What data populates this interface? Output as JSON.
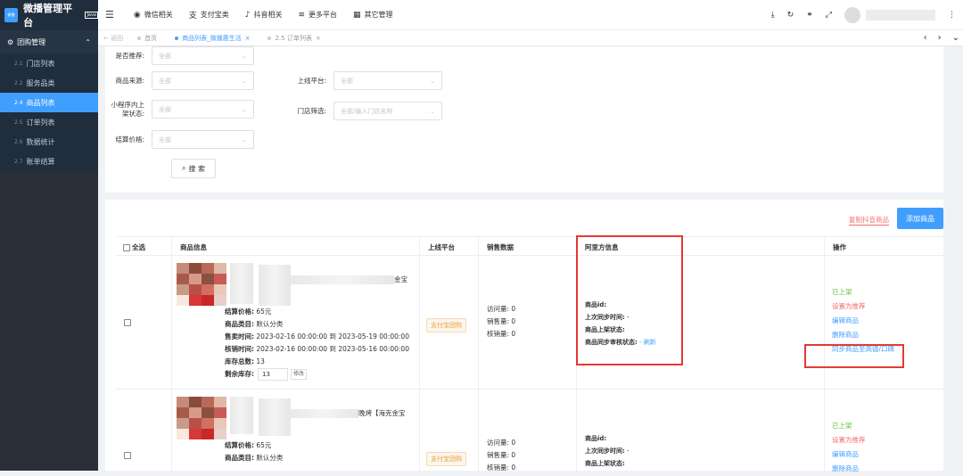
{
  "app": {
    "logo_badge": "微播\n助手",
    "title": "微播管理平台",
    "title_badge": "Java"
  },
  "sidebar": {
    "group": "团购管理",
    "items": [
      {
        "num": "2.1",
        "label": "门店列表"
      },
      {
        "num": "2.2",
        "label": "服务品类"
      },
      {
        "num": "2.4",
        "label": "商品列表"
      },
      {
        "num": "2.5",
        "label": "订单列表"
      },
      {
        "num": "2.6",
        "label": "数据统计"
      },
      {
        "num": "2.7",
        "label": "账单结算"
      }
    ]
  },
  "topnav": {
    "items": [
      "微信相关",
      "支付宝类",
      "抖音相关",
      "更多平台",
      "其它管理"
    ]
  },
  "tabs": {
    "back": "← 返回",
    "items": [
      "首页",
      "商品列表_微播惠生活",
      "2.5 订单列表"
    ]
  },
  "filters": {
    "recommend_label": "是否推荐:",
    "source_label": "商品来源:",
    "platform_label": "上线平台:",
    "mini_label_1": "小程序内上",
    "mini_label_2": "架状态:",
    "store_label": "门店筛选:",
    "price_label": "结算价格:",
    "all": "全部",
    "store_placeholder": "全部/输入门店名称",
    "search_btn": "搜 索"
  },
  "panel": {
    "copy_link": "复制抖音商品",
    "add_btn": "添加商品"
  },
  "table": {
    "headers": {
      "select_all": "全选",
      "info": "商品信息",
      "platform": "上线平台",
      "sales": "销售数据",
      "ali": "阿里方信息",
      "ops": "操作"
    },
    "rows": [
      {
        "title_tail": "金宝",
        "kv": [
          {
            "k": "结算价格:",
            "v": "65元"
          },
          {
            "k": "商品类目:",
            "v": "默认分类"
          },
          {
            "k": "售卖时间:",
            "v": "2023-02-16 00:00:00 到 2023-05-19 00:00:00"
          },
          {
            "k": "核销时间:",
            "v": "2023-02-16 00:00:00 到 2023-05-16 00:00:00"
          },
          {
            "k": "库存总数:",
            "v": "13"
          }
        ],
        "stock_label": "剩余库存:",
        "stock_value": "13",
        "modify": "修改",
        "platform": "支付宝团购",
        "sales": [
          {
            "k": "访问量:",
            "v": "0"
          },
          {
            "k": "销售量:",
            "v": "0"
          },
          {
            "k": "核销量:",
            "v": "0"
          }
        ],
        "ali": [
          {
            "k": "商品id:",
            "v": ""
          },
          {
            "k": "上次同步时间:",
            "v": "-"
          },
          {
            "k": "商品上架状态:",
            "v": ""
          },
          {
            "k": "商品同步审核状态:",
            "v": "- 刷新"
          }
        ],
        "ops": [
          "已上架",
          "设置为推荐",
          "编辑商品",
          "删除商品",
          "同步商品至高德/口碑"
        ]
      },
      {
        "title_tail": "晚烤【海克金宝",
        "kv": [
          {
            "k": "结算价格:",
            "v": "65元"
          },
          {
            "k": "商品类目:",
            "v": "默认分类"
          }
        ],
        "platform": "支付宝团购",
        "sales": [
          {
            "k": "访问量:",
            "v": "0"
          },
          {
            "k": "销售量:",
            "v": "0"
          },
          {
            "k": "核销量:",
            "v": "0"
          }
        ],
        "ali": [
          {
            "k": "商品id:",
            "v": ""
          },
          {
            "k": "上次同步时间:",
            "v": "-"
          },
          {
            "k": "商品上架状态:",
            "v": ""
          }
        ],
        "ops": [
          "已上架",
          "设置为推荐",
          "编辑商品",
          "删除商品"
        ]
      }
    ]
  },
  "colors": {
    "primary": "#409eff",
    "sidebar": "#2b2f3a",
    "green": "#67c23a",
    "red": "#f56c6c",
    "highlight": "#e53935"
  }
}
